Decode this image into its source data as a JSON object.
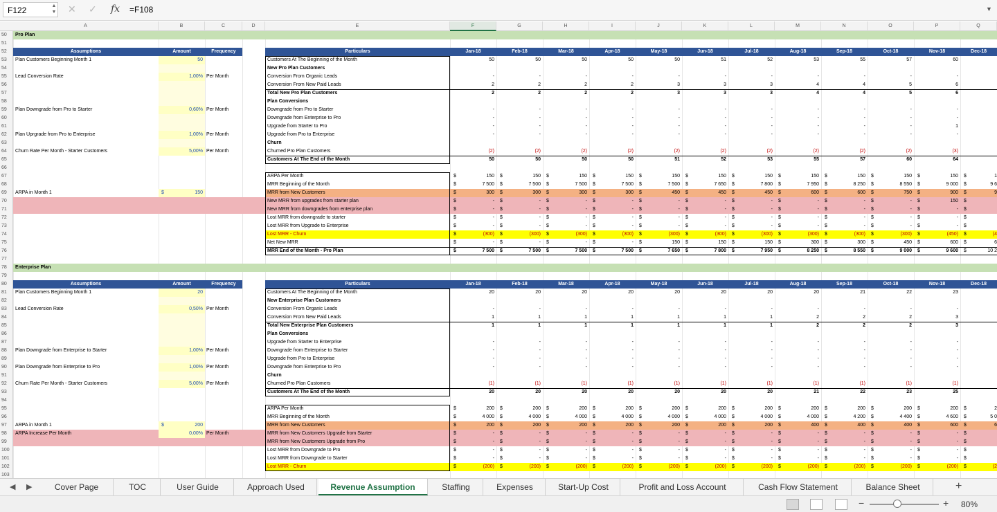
{
  "formula_bar": {
    "cell_ref": "F122",
    "fx": "fx",
    "formula": "=F108"
  },
  "columns": [
    "A",
    "B",
    "C",
    "D",
    "E",
    "F",
    "G",
    "H",
    "I",
    "J",
    "K",
    "L",
    "M",
    "N",
    "O",
    "P",
    "Q"
  ],
  "selected_column": "F",
  "months": [
    "Jan-18",
    "Feb-18",
    "Mar-18",
    "Apr-18",
    "May-18",
    "Jun-18",
    "Jul-18",
    "Aug-18",
    "Sep-18",
    "Oct-18",
    "Nov-18",
    "Dec-18"
  ],
  "pro": {
    "section_title": "Pro Plan",
    "assumptions_hdr": [
      "Assumptions",
      "Amount",
      "Frequency"
    ],
    "assumptions": [
      {
        "row": 53,
        "label": "Plan Customers Beginning Month 1",
        "amount": "50",
        "freq": ""
      },
      {
        "row": 55,
        "label": "Lead Conversion Rate",
        "amount": "1,00%",
        "freq": "Per Month"
      },
      {
        "row": 59,
        "label": "Plan Downgrade from Pro to Starter",
        "amount": "0,60%",
        "freq": "Per Month"
      },
      {
        "row": 62,
        "label": "Plan Uprgrade from Pro to Enterprise",
        "amount": "1,00%",
        "freq": "Per Month"
      },
      {
        "row": 64,
        "label": "Churn Rate Per Month - Starter Customers",
        "amount": "5,00%",
        "freq": "Per Month"
      }
    ],
    "arpa_label": "ARPA in Month 1",
    "arpa_dollar": "$",
    "arpa_value": "150",
    "particulars_hdr": "Particulars",
    "rows": [
      {
        "row": 53,
        "label": "Customers At The Beginning of the Month",
        "vals": [
          "50",
          "50",
          "50",
          "50",
          "50",
          "51",
          "52",
          "53",
          "55",
          "57",
          "60"
        ]
      },
      {
        "row": 54,
        "label": "New Pro Plan Customers",
        "bold": true,
        "vals": []
      },
      {
        "row": 55,
        "label": "Conversion From Organic Leads",
        "vals": [
          "-",
          "-",
          "-",
          "-",
          "-",
          "-",
          "-",
          "-",
          "-",
          "-",
          "-"
        ]
      },
      {
        "row": 56,
        "label": "Conversion From New Paid Leads",
        "vals": [
          "2",
          "2",
          "2",
          "2",
          "3",
          "3",
          "3",
          "4",
          "4",
          "5",
          "6"
        ]
      },
      {
        "row": 57,
        "label": "Total New Pro Plan Customers",
        "bold": true,
        "vals": [
          "2",
          "2",
          "2",
          "2",
          "3",
          "3",
          "3",
          "4",
          "4",
          "5",
          "6"
        ]
      },
      {
        "row": 58,
        "label": "Plan Conversions",
        "bold": true,
        "vals": []
      },
      {
        "row": 59,
        "label": "Downgrade from Pro to Starter",
        "vals": [
          "-",
          "-",
          "-",
          "-",
          "-",
          "-",
          "-",
          "-",
          "-",
          "-",
          "-"
        ]
      },
      {
        "row": 60,
        "label": "Downgrade from Enterprise to Pro",
        "vals": [
          "-",
          "-",
          "-",
          "-",
          "-",
          "-",
          "-",
          "-",
          "-",
          "-",
          "-"
        ]
      },
      {
        "row": 61,
        "label": "Upgrade from Starter to Pro",
        "vals": [
          "-",
          "-",
          "-",
          "-",
          "-",
          "-",
          "-",
          "-",
          "-",
          "-",
          "1"
        ]
      },
      {
        "row": 62,
        "label": "Upgrade from Pro to Enterprise",
        "vals": [
          "-",
          "-",
          "-",
          "-",
          "-",
          "-",
          "-",
          "-",
          "-",
          "-",
          "-"
        ]
      },
      {
        "row": 63,
        "label": "Churn",
        "bold": true,
        "vals": []
      },
      {
        "row": 64,
        "label": "Churned Pro Plan Customers",
        "red": true,
        "vals": [
          "(2)",
          "(2)",
          "(2)",
          "(2)",
          "(2)",
          "(2)",
          "(2)",
          "(2)",
          "(2)",
          "(2)",
          "(3)"
        ]
      },
      {
        "row": 65,
        "label": "Customers At The End of the Month",
        "bold": true,
        "vals": [
          "50",
          "50",
          "50",
          "50",
          "51",
          "52",
          "53",
          "55",
          "57",
          "60",
          "64"
        ]
      }
    ],
    "mrr_rows": [
      {
        "row": 67,
        "label": "ARPA Per Month",
        "vals": [
          "150",
          "150",
          "150",
          "150",
          "150",
          "150",
          "150",
          "150",
          "150",
          "150",
          "150"
        ],
        "tail": "1"
      },
      {
        "row": 68,
        "label": "MRR Beginning of the Month",
        "vals": [
          "7 500",
          "7 500",
          "7 500",
          "7 500",
          "7 500",
          "7 650",
          "7 800",
          "7 950",
          "8 250",
          "8 550",
          "9 000"
        ],
        "tail": "9 6"
      },
      {
        "row": 69,
        "label": "MRR from New Customers",
        "hl": "orange",
        "vals": [
          "300",
          "300",
          "300",
          "300",
          "450",
          "450",
          "450",
          "600",
          "600",
          "750",
          "900"
        ],
        "tail": "9"
      },
      {
        "row": 70,
        "label": "New MRR from upgrades from starter plan",
        "hl": "pink",
        "vals": [
          "-",
          "-",
          "-",
          "-",
          "-",
          "-",
          "-",
          "-",
          "-",
          "-",
          "150"
        ],
        "tail": ""
      },
      {
        "row": 71,
        "label": "New MRR from downgrades from enterprise plan",
        "hl": "pink",
        "vals": [
          "-",
          "-",
          "-",
          "-",
          "-",
          "-",
          "-",
          "-",
          "-",
          "-",
          "-"
        ],
        "tail": ""
      },
      {
        "row": 72,
        "label": "Lost MRR from downgrade to starter",
        "vals": [
          "-",
          "-",
          "-",
          "-",
          "-",
          "-",
          "-",
          "-",
          "-",
          "-",
          "-"
        ],
        "tail": ""
      },
      {
        "row": 73,
        "label": "Lost MRR from Upgrade to Enterprise",
        "vals": [
          "-",
          "-",
          "-",
          "-",
          "-",
          "-",
          "-",
          "-",
          "-",
          "-",
          "-"
        ],
        "tail": ""
      },
      {
        "row": 74,
        "label": "Lost MRR - Churn",
        "hl": "yellow",
        "red": true,
        "vals": [
          "(300)",
          "(300)",
          "(300)",
          "(300)",
          "(300)",
          "(300)",
          "(300)",
          "(300)",
          "(300)",
          "(300)",
          "(450)"
        ],
        "tail": "(4"
      },
      {
        "row": 75,
        "label": "Net New MRR",
        "vals": [
          "-",
          "-",
          "-",
          "-",
          "150",
          "150",
          "150",
          "300",
          "300",
          "450",
          "600"
        ],
        "tail": "6"
      },
      {
        "row": 76,
        "label": "MRR End of the Month - Pro Plan",
        "bold": true,
        "vals": [
          "7 500",
          "7 500",
          "7 500",
          "7 500",
          "7 650",
          "7 800",
          "7 950",
          "8 250",
          "8 550",
          "9 000",
          "9 600"
        ],
        "tail": "10 2"
      }
    ]
  },
  "ent": {
    "section_title": "Enterprise Plan",
    "assumptions_hdr": [
      "Assumptions",
      "Amount",
      "Frequency"
    ],
    "assumptions": [
      {
        "row": 81,
        "label": "Plan Customers Beginning Month 1",
        "amount": "20",
        "freq": ""
      },
      {
        "row": 83,
        "label": "Lead Conversion Rate",
        "amount": "0,50%",
        "freq": "Per Month"
      },
      {
        "row": 88,
        "label": "Plan Downgrade from Enterprise to Starter",
        "amount": "1,00%",
        "freq": "Per Month"
      },
      {
        "row": 90,
        "label": "Plan Downgrade from Enterprise to Pro",
        "amount": "1,00%",
        "freq": "Per Month"
      },
      {
        "row": 92,
        "label": "Churn Rate Per Month - Starter Customers",
        "amount": "5,00%",
        "freq": "Per Month"
      }
    ],
    "arpa_label": "ARPA in Month 1",
    "arpa_dollar": "$",
    "arpa_value": "200",
    "arpa_inc_label": "ARPA Increase Per Month",
    "arpa_inc_value": "0,00%",
    "arpa_inc_freq": "Per Month",
    "particulars_hdr": "Particulars",
    "rows": [
      {
        "row": 81,
        "label": "Customers At The Beginning of the Month",
        "vals": [
          "20",
          "20",
          "20",
          "20",
          "20",
          "20",
          "20",
          "20",
          "21",
          "22",
          "23"
        ]
      },
      {
        "row": 82,
        "label": "New Enterprise Plan Customers",
        "bold": true,
        "vals": []
      },
      {
        "row": 83,
        "label": "Conversion From Organic Leads",
        "vals": [
          "-",
          "-",
          "-",
          "-",
          "-",
          "-",
          "-",
          "-",
          "-",
          "-",
          "-"
        ]
      },
      {
        "row": 84,
        "label": "Conversion From New Paid Leads",
        "vals": [
          "1",
          "1",
          "1",
          "1",
          "1",
          "1",
          "1",
          "2",
          "2",
          "2",
          "3"
        ]
      },
      {
        "row": 85,
        "label": "Total New Enterprise Plan Customers",
        "bold": true,
        "vals": [
          "1",
          "1",
          "1",
          "1",
          "1",
          "1",
          "1",
          "2",
          "2",
          "2",
          "3"
        ]
      },
      {
        "row": 86,
        "label": "Plan Conversions",
        "bold": true,
        "vals": []
      },
      {
        "row": 87,
        "label": "Upgrade from Starter to Enterprise",
        "vals": [
          "-",
          "-",
          "-",
          "-",
          "-",
          "-",
          "-",
          "-",
          "-",
          "-",
          "-"
        ]
      },
      {
        "row": 88,
        "label": "Downgrade from Enterprise to Starter",
        "vals": [
          "-",
          "-",
          "-",
          "-",
          "-",
          "-",
          "-",
          "-",
          "-",
          "-",
          "-"
        ]
      },
      {
        "row": 89,
        "label": "Upgrade from Pro to Enterprise",
        "vals": [
          "-",
          "-",
          "-",
          "-",
          "-",
          "-",
          "-",
          "-",
          "-",
          "-",
          "-"
        ]
      },
      {
        "row": 90,
        "label": "Downgrade from Enterprise to Pro",
        "vals": [
          "-",
          "-",
          "-",
          "-",
          "-",
          "-",
          "-",
          "-",
          "-",
          "-",
          "-"
        ]
      },
      {
        "row": 91,
        "label": "Churn",
        "bold": true,
        "vals": []
      },
      {
        "row": 92,
        "label": "Churned Pro Plan Customers",
        "red": true,
        "vals": [
          "(1)",
          "(1)",
          "(1)",
          "(1)",
          "(1)",
          "(1)",
          "(1)",
          "(1)",
          "(1)",
          "(1)",
          "(1)"
        ]
      },
      {
        "row": 93,
        "label": "Customers At The End of the Month",
        "bold": true,
        "vals": [
          "20",
          "20",
          "20",
          "20",
          "20",
          "20",
          "20",
          "21",
          "22",
          "23",
          "25"
        ]
      }
    ],
    "mrr_rows": [
      {
        "row": 95,
        "label": "ARPA Per Month",
        "vals": [
          "200",
          "200",
          "200",
          "200",
          "200",
          "200",
          "200",
          "200",
          "200",
          "200",
          "200"
        ],
        "tail": "2"
      },
      {
        "row": 96,
        "label": "MRR Beginning of the Month",
        "vals": [
          "4 000",
          "4 000",
          "4 000",
          "4 000",
          "4 000",
          "4 000",
          "4 000",
          "4 000",
          "4 200",
          "4 400",
          "4 600"
        ],
        "tail": "5 0"
      },
      {
        "row": 97,
        "label": "MRR from New Customers",
        "hl": "orange",
        "vals": [
          "200",
          "200",
          "200",
          "200",
          "200",
          "200",
          "200",
          "400",
          "400",
          "400",
          "600"
        ],
        "tail": "6"
      },
      {
        "row": 98,
        "label": "MRR from New Customers Upgrade from Starter",
        "hl": "pink",
        "vals": [
          "-",
          "-",
          "-",
          "-",
          "-",
          "-",
          "-",
          "-",
          "-",
          "-",
          "-"
        ],
        "tail": ""
      },
      {
        "row": 99,
        "label": "MRR from New Customers Upgrade from Pro",
        "hl": "pink",
        "vals": [
          "-",
          "-",
          "-",
          "-",
          "-",
          "-",
          "-",
          "-",
          "-",
          "-",
          "-"
        ],
        "tail": ""
      },
      {
        "row": 100,
        "label": "Lost MRR from Downgrade to Pro",
        "vals": [
          "-",
          "-",
          "-",
          "-",
          "-",
          "-",
          "-",
          "-",
          "-",
          "-",
          "-"
        ],
        "tail": ""
      },
      {
        "row": 101,
        "label": "Lost MRR from Downgrade to Starter",
        "vals": [
          "-",
          "-",
          "-",
          "-",
          "-",
          "-",
          "-",
          "-",
          "-",
          "-",
          "-"
        ],
        "tail": ""
      },
      {
        "row": 102,
        "label": "Lost MRR - Churn",
        "hl": "yellow",
        "red": true,
        "vals": [
          "(200)",
          "(200)",
          "(200)",
          "(200)",
          "(200)",
          "(200)",
          "(200)",
          "(200)",
          "(200)",
          "(200)",
          "(200)"
        ],
        "tail": "(2"
      }
    ]
  },
  "tabs": {
    "items": [
      "Cover Page",
      "TOC",
      "User Guide",
      "Approach Used",
      "Revenue Assumption",
      "Staffing",
      "Expenses",
      "Start-Up Cost",
      "Profit and Loss Account",
      "Cash Flow Statement",
      "Balance Sheet"
    ],
    "active": "Revenue Assumption"
  },
  "status": {
    "zoom": "80%",
    "minus": "−",
    "plus": "+"
  }
}
